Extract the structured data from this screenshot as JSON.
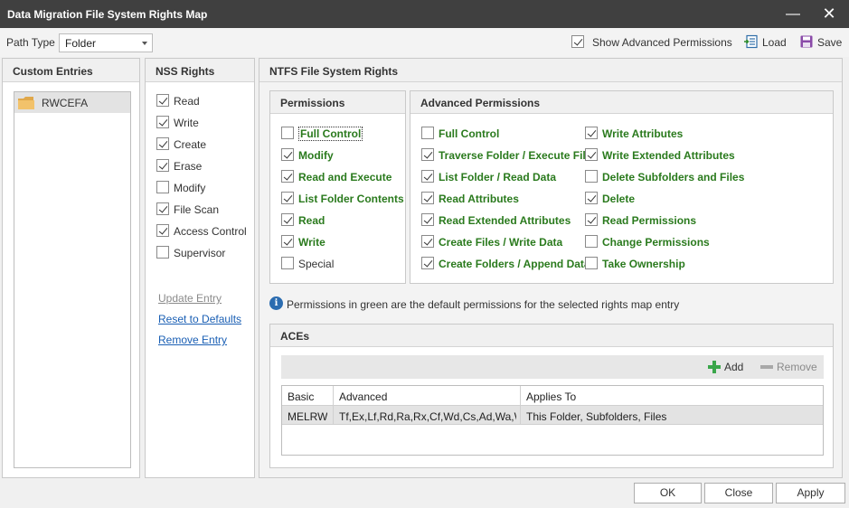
{
  "window": {
    "title": "Data Migration File System Rights Map",
    "minimize_glyph": "—",
    "close_glyph": "✕"
  },
  "toolbar": {
    "path_type_label": "Path Type",
    "path_type_value": "Folder",
    "show_advanced_label": "Show Advanced Permissions",
    "show_advanced_checked": true,
    "load_label": "Load",
    "save_label": "Save"
  },
  "custom_entries": {
    "header": "Custom Entries",
    "items": [
      {
        "label": "RWCEFA",
        "icon": "folder-icon",
        "selected": true
      }
    ]
  },
  "nss_rights": {
    "header": "NSS Rights",
    "items": [
      {
        "label": "Read",
        "checked": true
      },
      {
        "label": "Write",
        "checked": true
      },
      {
        "label": "Create",
        "checked": true
      },
      {
        "label": "Erase",
        "checked": true
      },
      {
        "label": "Modify",
        "checked": false
      },
      {
        "label": "File Scan",
        "checked": true
      },
      {
        "label": "Access Control",
        "checked": true
      },
      {
        "label": "Supervisor",
        "checked": false
      }
    ],
    "links": {
      "update_entry": "Update Entry",
      "reset_defaults": "Reset to Defaults",
      "remove_entry": "Remove Entry"
    }
  },
  "ntfs": {
    "header": "NTFS File System Rights",
    "permissions": {
      "header": "Permissions",
      "items": [
        {
          "label": "Full Control",
          "checked": false,
          "default": true
        },
        {
          "label": "Modify",
          "checked": true,
          "default": true
        },
        {
          "label": "Read and Execute",
          "checked": true,
          "default": true
        },
        {
          "label": "List Folder Contents",
          "checked": true,
          "default": true
        },
        {
          "label": "Read",
          "checked": true,
          "default": true
        },
        {
          "label": "Write",
          "checked": true,
          "default": true
        },
        {
          "label": "Special",
          "checked": false,
          "default": false
        }
      ]
    },
    "advanced": {
      "header": "Advanced Permissions",
      "col1": [
        {
          "label": "Full Control",
          "checked": false,
          "default": true
        },
        {
          "label": "Traverse Folder / Execute File",
          "checked": true,
          "default": true
        },
        {
          "label": "List Folder / Read Data",
          "checked": true,
          "default": true
        },
        {
          "label": "Read Attributes",
          "checked": true,
          "default": true
        },
        {
          "label": "Read Extended Attributes",
          "checked": true,
          "default": true
        },
        {
          "label": "Create Files / Write Data",
          "checked": true,
          "default": true
        },
        {
          "label": "Create Folders / Append Data",
          "checked": true,
          "default": true
        }
      ],
      "col2": [
        {
          "label": "Write Attributes",
          "checked": true,
          "default": true
        },
        {
          "label": "Write Extended Attributes",
          "checked": true,
          "default": true
        },
        {
          "label": "Delete Subfolders and Files",
          "checked": false,
          "default": true
        },
        {
          "label": "Delete",
          "checked": true,
          "default": true
        },
        {
          "label": "Read Permissions",
          "checked": true,
          "default": true
        },
        {
          "label": "Change Permissions",
          "checked": false,
          "default": true
        },
        {
          "label": "Take Ownership",
          "checked": false,
          "default": true
        }
      ]
    },
    "info_text": "Permissions in green are the default permissions for the selected rights map entry",
    "aces": {
      "header": "ACEs",
      "add_label": "Add",
      "remove_label": "Remove",
      "columns": [
        "Basic",
        "Advanced",
        "Applies To"
      ],
      "rows": [
        [
          "MELRW",
          "Tf,Ex,Lf,Rd,Ra,Rx,Cf,Wd,Cs,Ad,Wa,W...",
          "This Folder, Subfolders, Files"
        ]
      ]
    }
  },
  "footer": {
    "ok": "OK",
    "close": "Close",
    "apply": "Apply"
  },
  "colors": {
    "default_permission": "#2a7a1d",
    "titlebar": "#404040",
    "link": "#1a5fb4"
  }
}
